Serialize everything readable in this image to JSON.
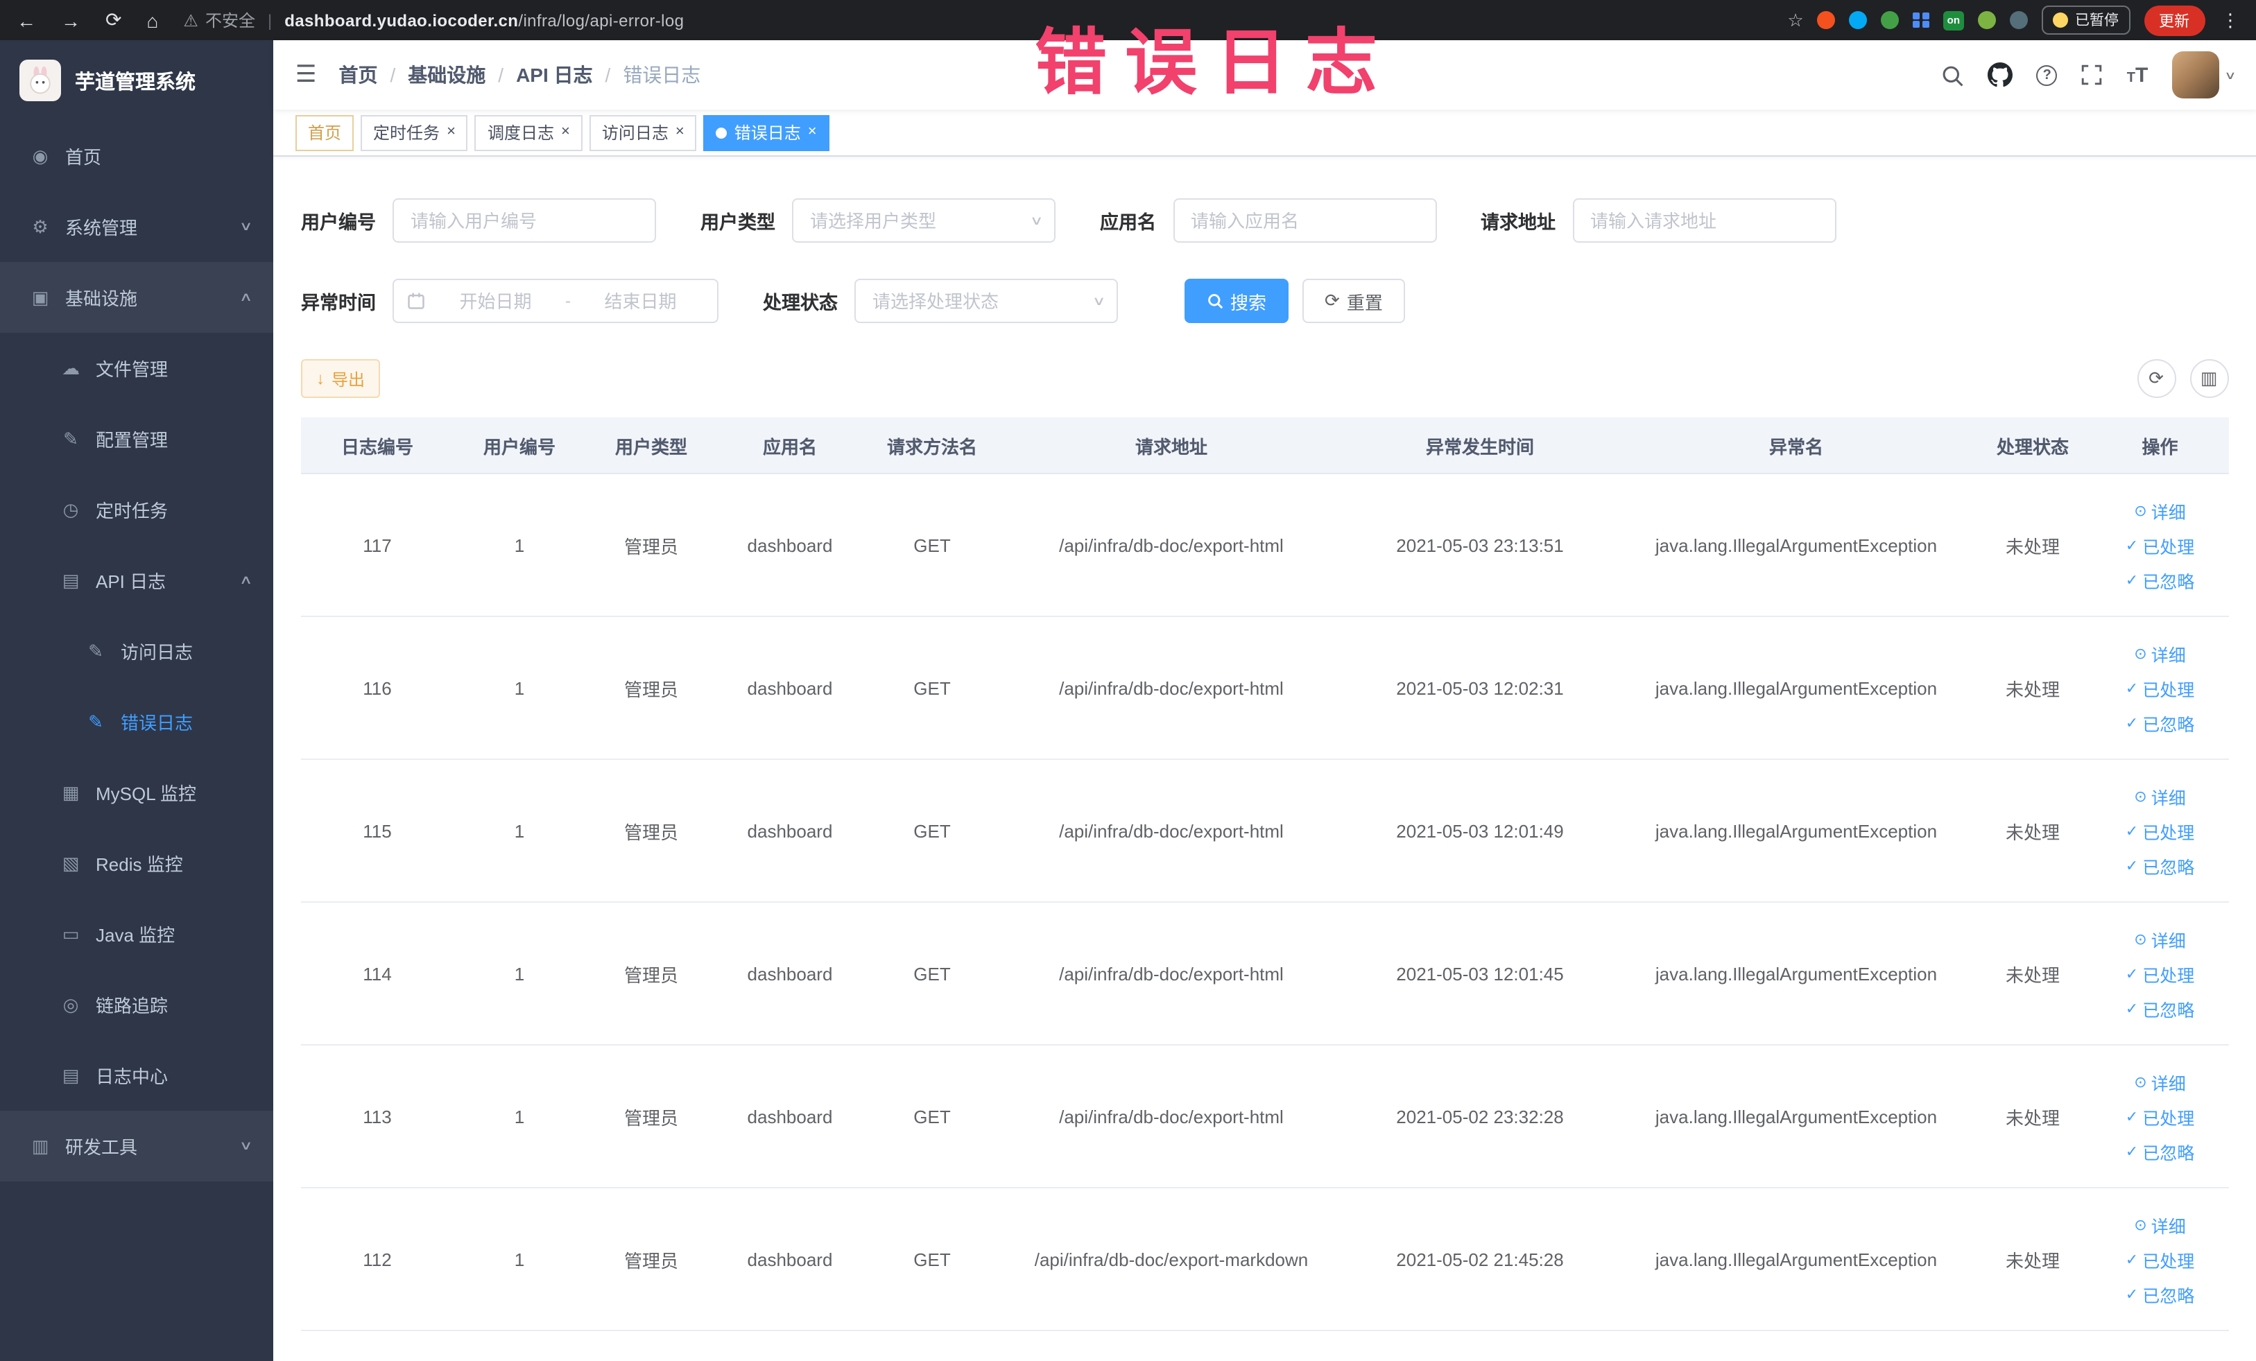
{
  "colors": {
    "accent": "#409eff",
    "warning": "#e6a23c",
    "annotation_pink": "#f1416c",
    "sidebar_bg": "#2e3648",
    "table_header_bg": "#f1f4f9"
  },
  "browser": {
    "security_label": "不安全",
    "url_host": "dashboard.yudao.iocoder.cn",
    "url_path": "/infra/log/api-error-log",
    "ext_on_label": "on",
    "paused_badge": "已暂停",
    "update_button": "更新"
  },
  "annotation": {
    "text": "错误日志"
  },
  "sidebar": {
    "logo_title": "芋道管理系统",
    "items": [
      {
        "name": "sidebar-item-home",
        "icon": "dashboard-icon",
        "glyph": "◉",
        "label": "首页",
        "level": 1
      },
      {
        "name": "sidebar-item-system-management",
        "icon": "gear-icon",
        "glyph": "⚙",
        "label": "系统管理",
        "level": 1,
        "arrow": "down"
      },
      {
        "name": "sidebar-item-infrastructure",
        "icon": "infrastructure-icon",
        "glyph": "▣",
        "label": "基础设施",
        "level": 1,
        "arrow": "up",
        "section": true
      },
      {
        "name": "sidebar-item-file-management",
        "icon": "cloud-icon",
        "glyph": "☁",
        "label": "文件管理",
        "level": 2
      },
      {
        "name": "sidebar-item-config-management",
        "icon": "pencil-icon",
        "glyph": "✎",
        "label": "配置管理",
        "level": 2
      },
      {
        "name": "sidebar-item-cron-jobs",
        "icon": "clock-icon",
        "glyph": "◷",
        "label": "定时任务",
        "level": 2
      },
      {
        "name": "sidebar-item-api-logs",
        "icon": "log-icon",
        "glyph": "▤",
        "label": "API 日志",
        "level": 2,
        "arrow": "up"
      },
      {
        "name": "sidebar-item-access-log",
        "icon": "doc-edit-icon",
        "glyph": "✎",
        "label": "访问日志",
        "level": 3
      },
      {
        "name": "sidebar-item-error-log",
        "icon": "doc-edit-icon",
        "glyph": "✎",
        "label": "错误日志",
        "level": 3,
        "active": true
      },
      {
        "name": "sidebar-item-mysql-monitor",
        "icon": "grid-icon",
        "glyph": "▦",
        "label": "MySQL 监控",
        "level": 2
      },
      {
        "name": "sidebar-item-redis-monitor",
        "icon": "layers-icon",
        "glyph": "▧",
        "label": "Redis 监控",
        "level": 2
      },
      {
        "name": "sidebar-item-java-monitor",
        "icon": "monitor-icon",
        "glyph": "▭",
        "label": "Java 监控",
        "level": 2
      },
      {
        "name": "sidebar-item-trace",
        "icon": "eye-icon",
        "glyph": "◎",
        "label": "链路追踪",
        "level": 2
      },
      {
        "name": "sidebar-item-log-center",
        "icon": "log-icon",
        "glyph": "▤",
        "label": "日志中心",
        "level": 2
      },
      {
        "name": "sidebar-item-dev-tools",
        "icon": "toolbox-icon",
        "glyph": "▥",
        "label": "研发工具",
        "level": 1,
        "arrow": "down",
        "section": true
      }
    ]
  },
  "header": {
    "breadcrumb": [
      "首页",
      "基础设施",
      "API 日志",
      "错误日志"
    ]
  },
  "tags": [
    {
      "label": "首页",
      "closable": false,
      "active": false,
      "affix": true
    },
    {
      "label": "定时任务",
      "closable": true,
      "active": false
    },
    {
      "label": "调度日志",
      "closable": true,
      "active": false
    },
    {
      "label": "访问日志",
      "closable": true,
      "active": false
    },
    {
      "label": "错误日志",
      "closable": true,
      "active": true
    }
  ],
  "filters": {
    "user_id": {
      "label": "用户编号",
      "placeholder": "请输入用户编号",
      "value": ""
    },
    "user_type": {
      "label": "用户类型",
      "placeholder": "请选择用户类型",
      "value": ""
    },
    "app_name": {
      "label": "应用名",
      "placeholder": "请输入应用名",
      "value": ""
    },
    "request_url": {
      "label": "请求地址",
      "placeholder": "请输入请求地址",
      "value": ""
    },
    "exception_time": {
      "label": "异常时间",
      "start_placeholder": "开始日期",
      "separator": "-",
      "end_placeholder": "结束日期",
      "value": ""
    },
    "process_status": {
      "label": "处理状态",
      "placeholder": "请选择处理状态",
      "value": ""
    },
    "search_button": "搜索",
    "reset_button": "重置"
  },
  "toolbar": {
    "export_button": "导出"
  },
  "table": {
    "columns": [
      "日志编号",
      "用户编号",
      "用户类型",
      "应用名",
      "请求方法名",
      "请求地址",
      "异常发生时间",
      "异常名",
      "处理状态",
      "操作"
    ],
    "row_fields": [
      "log_id",
      "user_id",
      "user_type",
      "app_name",
      "method",
      "url",
      "time",
      "exception",
      "status"
    ],
    "row_actions": [
      "详细",
      "已处理",
      "已忽略"
    ],
    "rows": [
      {
        "log_id": "117",
        "user_id": "1",
        "user_type": "管理员",
        "app_name": "dashboard",
        "method": "GET",
        "url": "/api/infra/db-doc/export-html",
        "time": "2021-05-03 23:13:51",
        "exception": "java.lang.IllegalArgumentException",
        "status": "未处理"
      },
      {
        "log_id": "116",
        "user_id": "1",
        "user_type": "管理员",
        "app_name": "dashboard",
        "method": "GET",
        "url": "/api/infra/db-doc/export-html",
        "time": "2021-05-03 12:02:31",
        "exception": "java.lang.IllegalArgumentException",
        "status": "未处理"
      },
      {
        "log_id": "115",
        "user_id": "1",
        "user_type": "管理员",
        "app_name": "dashboard",
        "method": "GET",
        "url": "/api/infra/db-doc/export-html",
        "time": "2021-05-03 12:01:49",
        "exception": "java.lang.IllegalArgumentException",
        "status": "未处理"
      },
      {
        "log_id": "114",
        "user_id": "1",
        "user_type": "管理员",
        "app_name": "dashboard",
        "method": "GET",
        "url": "/api/infra/db-doc/export-html",
        "time": "2021-05-03 12:01:45",
        "exception": "java.lang.IllegalArgumentException",
        "status": "未处理"
      },
      {
        "log_id": "113",
        "user_id": "1",
        "user_type": "管理员",
        "app_name": "dashboard",
        "method": "GET",
        "url": "/api/infra/db-doc/export-html",
        "time": "2021-05-02 23:32:28",
        "exception": "java.lang.IllegalArgumentException",
        "status": "未处理"
      },
      {
        "log_id": "112",
        "user_id": "1",
        "user_type": "管理员",
        "app_name": "dashboard",
        "method": "GET",
        "url": "/api/infra/db-doc/export-markdown",
        "time": "2021-05-02 21:45:28",
        "exception": "java.lang.IllegalArgumentException",
        "status": "未处理"
      }
    ]
  }
}
